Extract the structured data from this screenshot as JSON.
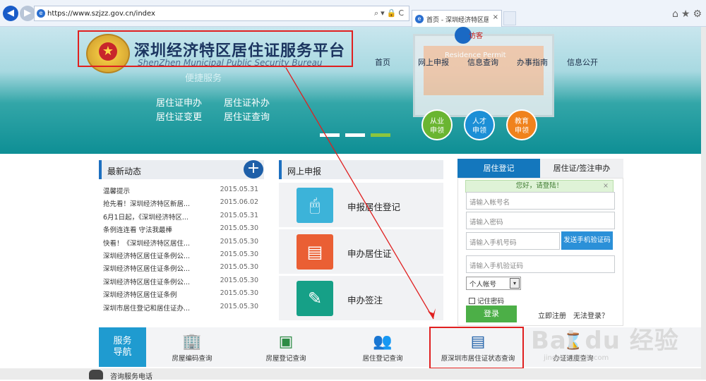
{
  "browser": {
    "url": "https://www.szjzz.gov.cn/index",
    "tab_title": "首页 - 深圳经济特区居住证...",
    "address_tools": "⌕▾🔒C",
    "close": "×",
    "win_icons": "⌂★⚙"
  },
  "header": {
    "title_cn": "深圳经济特区居住证服务平台",
    "title_en": "ShenZhen Municipal Public Security Bureau",
    "emblem_star": "★",
    "visitor_label": "访客",
    "nav": [
      "首页",
      "网上申报",
      "信息查询",
      "办事指南",
      "信息公开"
    ]
  },
  "hero": {
    "slogan": "便捷服务",
    "monitor_text": "Residence Permit",
    "links": [
      "居住证申办",
      "居住证补办",
      "居住证变更",
      "居住证查询"
    ],
    "circles": [
      {
        "label": "从业\n申领",
        "color": "#6ab531"
      },
      {
        "label": "人才\n申领",
        "color": "#1c8fd6"
      },
      {
        "label": "教育\n申领",
        "color": "#f0821c"
      }
    ]
  },
  "news": {
    "title": "最新动态",
    "more_icon": "+",
    "items": [
      {
        "title": "温馨提示",
        "date": "2015.05.31"
      },
      {
        "title": "抢先看！深圳经济特区新居...",
        "date": "2015.06.02"
      },
      {
        "title": "6月1日起，《深圳经济特区...",
        "date": "2015.05.31"
      },
      {
        "title": "条例连连看 守法我最棒",
        "date": "2015.05.30"
      },
      {
        "title": "快看！《深圳经济特区居住...",
        "date": "2015.05.30"
      },
      {
        "title": "深圳经济特区居住证条例公...",
        "date": "2015.05.30"
      },
      {
        "title": "深圳经济特区居住证条例公...",
        "date": "2015.05.30"
      },
      {
        "title": "深圳经济特区居住证条例公...",
        "date": "2015.05.30"
      },
      {
        "title": "深圳经济特区居住证条例",
        "date": "2015.05.30"
      },
      {
        "title": "深圳市居住登记和居住证办...",
        "date": "2015.05.30"
      }
    ]
  },
  "apply": {
    "title": "网上申报",
    "items": [
      {
        "label": "申报居住登记",
        "color": "#3cb3d9",
        "icon": "🖱"
      },
      {
        "label": "申办居住证",
        "color": "#ea5f34",
        "icon": "▤"
      },
      {
        "label": "申办签注",
        "color": "#16a087",
        "icon": "✎"
      }
    ]
  },
  "login": {
    "tab_active": "居住登记",
    "tab_other": "居住证/签注申办",
    "hello": "您好，请登陆！",
    "hello_close": "×",
    "account_placeholder": "请输入帐号名",
    "password_placeholder": "请输入密码",
    "phone_placeholder": "请输入手机号码",
    "sms_button": "发送手机验证码",
    "sms_code_placeholder": "请输入手机验证码",
    "account_type": "个人帐号",
    "select_arrow": "▾",
    "remember": "记住密码",
    "login_button": "登录",
    "register": "立即注册",
    "forgot": "无法登录？"
  },
  "services": {
    "label": "服务\n导航",
    "items": [
      {
        "label": "房屋编码查询",
        "icon": "🏢",
        "color": "#d9352c"
      },
      {
        "label": "房屋登记查询",
        "icon": "▣",
        "color": "#2e8b45"
      },
      {
        "label": "居住登记查询",
        "icon": "👥",
        "color": "#1c7fc2"
      },
      {
        "label": "原深圳市居住证状态查询",
        "icon": "▤",
        "color": "#1e5fa8"
      },
      {
        "label": "办证进度查询",
        "icon": "⌛",
        "color": "#2e8b45"
      }
    ]
  },
  "footer": {
    "hotline": "咨询服务电话"
  },
  "watermark": {
    "brand": "Bai du 经验",
    "site": "jingyan.baidu.com"
  }
}
